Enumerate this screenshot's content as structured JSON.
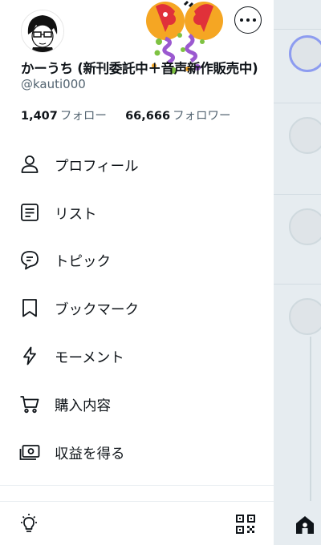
{
  "profile": {
    "display_name": "かーうち (新刊委託中＋音声新作販売中)",
    "handle": "@kauti000",
    "following_count": "1,407",
    "following_label": "フォロー",
    "followers_count": "66,666",
    "followers_label": "フォロワー"
  },
  "menu": {
    "items": [
      {
        "label": "プロフィール",
        "icon": "person-icon"
      },
      {
        "label": "リスト",
        "icon": "list-icon"
      },
      {
        "label": "トピック",
        "icon": "topic-icon"
      },
      {
        "label": "ブックマーク",
        "icon": "bookmark-icon"
      },
      {
        "label": "モーメント",
        "icon": "lightning-icon"
      },
      {
        "label": "購入内容",
        "icon": "cart-icon"
      },
      {
        "label": "収益を得る",
        "icon": "money-icon"
      }
    ]
  },
  "colors": {
    "text": "#0f1419",
    "secondary": "#536471",
    "background_pane": "#e6ecf0"
  }
}
